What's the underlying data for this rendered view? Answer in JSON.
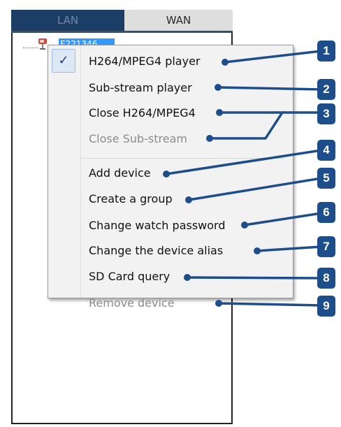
{
  "tabs": [
    {
      "label": "LAN",
      "active": true
    },
    {
      "label": "WAN",
      "active": false
    }
  ],
  "tree": {
    "node_label": "E221346"
  },
  "menu": {
    "check_mark": "✓",
    "items": [
      {
        "label": "H264/MPEG4 player",
        "enabled": true,
        "checked": true
      },
      {
        "label": "Sub-stream player",
        "enabled": true
      },
      {
        "label": "Close H264/MPEG4",
        "enabled": true
      },
      {
        "label": "Close Sub-stream",
        "enabled": false
      },
      {
        "label": "Add device",
        "enabled": true
      },
      {
        "label": "Create a group",
        "enabled": true
      },
      {
        "label": "Change watch password",
        "enabled": true
      },
      {
        "label": "Change the device alias",
        "enabled": true
      },
      {
        "label": "SD Card query",
        "enabled": true
      },
      {
        "label": "Remove device",
        "enabled": false
      }
    ]
  },
  "callouts": [
    "1",
    "2",
    "3",
    "4",
    "5",
    "6",
    "7",
    "8",
    "9"
  ],
  "colors": {
    "callout": "#1e4d8c",
    "selection": "#3399ff",
    "lan_tab": "#1b3d66"
  }
}
